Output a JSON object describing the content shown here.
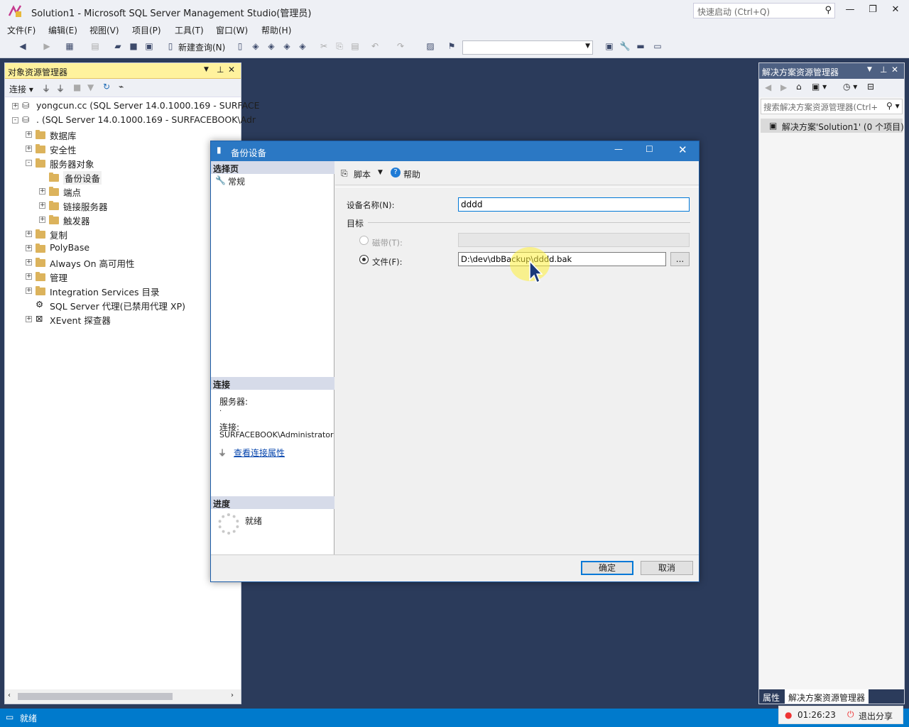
{
  "window": {
    "title": "Solution1 - Microsoft SQL Server Management Studio(管理员)",
    "quick_launch_placeholder": "快速启动 (Ctrl+Q)"
  },
  "menu": [
    "文件(F)",
    "编辑(E)",
    "视图(V)",
    "项目(P)",
    "工具(T)",
    "窗口(W)",
    "帮助(H)"
  ],
  "toolbar": {
    "new_query_label": "新建查询(N)"
  },
  "object_explorer": {
    "title": "对象资源管理器",
    "connect_label": "连接",
    "tree": [
      {
        "label": "yongcun.cc (SQL Server 14.0.1000.169 - SURFACE",
        "level": 0,
        "exp": "+"
      },
      {
        "label": ". (SQL Server 14.0.1000.169 - SURFACEBOOK\\Adr",
        "level": 0,
        "exp": "-"
      },
      {
        "label": "数据库",
        "level": 1,
        "exp": "+"
      },
      {
        "label": "安全性",
        "level": 1,
        "exp": "+"
      },
      {
        "label": "服务器对象",
        "level": 1,
        "exp": "-"
      },
      {
        "label": "备份设备",
        "level": 2,
        "exp": ""
      },
      {
        "label": "端点",
        "level": 2,
        "exp": "+"
      },
      {
        "label": "链接服务器",
        "level": 2,
        "exp": "+"
      },
      {
        "label": "触发器",
        "level": 2,
        "exp": "+"
      },
      {
        "label": "复制",
        "level": 1,
        "exp": "+"
      },
      {
        "label": "PolyBase",
        "level": 1,
        "exp": "+"
      },
      {
        "label": "Always On 高可用性",
        "level": 1,
        "exp": "+"
      },
      {
        "label": "管理",
        "level": 1,
        "exp": "+"
      },
      {
        "label": "Integration Services 目录",
        "level": 1,
        "exp": "+"
      },
      {
        "label": "SQL Server 代理(已禁用代理 XP)",
        "level": 1,
        "exp": ""
      },
      {
        "label": "XEvent 探查器",
        "level": 1,
        "exp": "+"
      }
    ]
  },
  "solution_explorer": {
    "title": "解决方案资源管理器",
    "search_placeholder": "搜索解决方案资源管理器(Ctrl+",
    "item": "解决方案'Solution1' (0 个项目)",
    "tab_properties": "属性",
    "tab_solution": "解决方案资源管理器"
  },
  "status": {
    "text": "就绪",
    "timer": "01:26:23",
    "exit_share": "退出分享"
  },
  "dialog": {
    "title": "备份设备",
    "select_page": "选择页",
    "page_general": "常规",
    "connection_header": "连接",
    "server_label": "服务器:",
    "server_value": ".",
    "connection_label": "连接:",
    "connection_value": "SURFACEBOOK\\Administrator",
    "view_conn_props": "查看连接属性",
    "progress_header": "进度",
    "progress_status": "就绪",
    "script_label": "脚本",
    "help_label": "帮助",
    "device_name_label": "设备名称(N):",
    "device_name_value": "dddd",
    "target_label": "目标",
    "tape_label": "磁带(T):",
    "file_label": "文件(F):",
    "file_value": "D:\\dev\\dbBackup\\dddd.bak",
    "browse_label": "...",
    "ok_label": "确定",
    "cancel_label": "取消"
  }
}
